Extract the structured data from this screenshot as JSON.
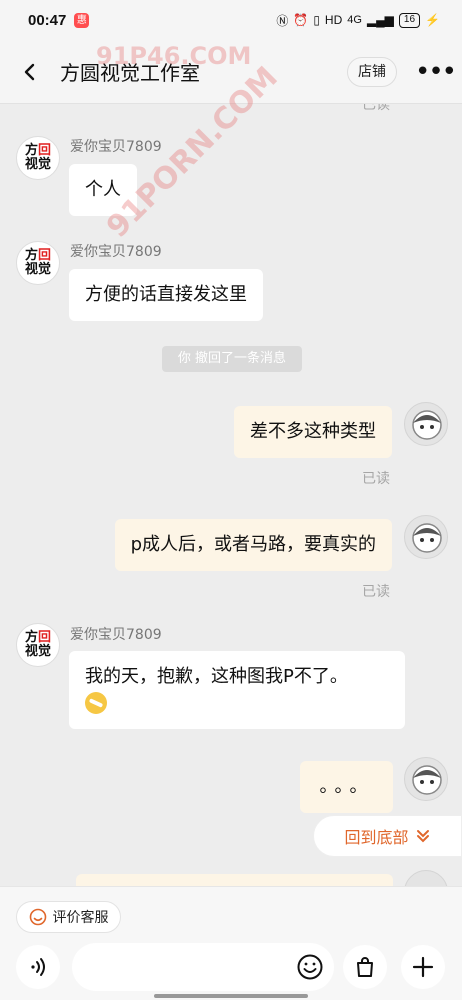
{
  "status_bar": {
    "time": "00:47",
    "app_icon": "惠",
    "network": "4G",
    "battery": "16",
    "icons": [
      "nfc-icon",
      "alarm-icon",
      "vibrate-icon",
      "hd-icon",
      "signal-icon",
      "charging-icon"
    ]
  },
  "header": {
    "title": "方圆视觉工作室",
    "shop_label": "店铺",
    "more_label": "•••"
  },
  "chat": {
    "top_read": "已读",
    "shop_avatar": {
      "line1": "方",
      "line1_red": "回",
      "line2": "视觉"
    },
    "messages": [
      {
        "sender": "爱你宝贝7809",
        "text": "个人"
      },
      {
        "sender": "爱你宝贝7809",
        "text": "方便的话直接发这里"
      },
      {
        "recall": "你 撤回了一条消息"
      },
      {
        "text": "差不多这种类型",
        "read": "已读"
      },
      {
        "text": "p成人后，或者马路，要真实的",
        "read": "已读"
      },
      {
        "sender": "爱你宝贝7809",
        "text": "我的天，抱歉，这种图我P不了。"
      },
      {
        "text": "。。。"
      }
    ]
  },
  "scroll_to_bottom": {
    "label": "回到底部"
  },
  "bottom": {
    "rate_label": "评价客服",
    "input_placeholder": ""
  },
  "watermarks": [
    "91P46.COM",
    "91PORN.COM",
    "91PORN.COM"
  ],
  "colors": {
    "accent": "#e0672c",
    "bubble_out": "#fdf5e6",
    "bubble_in": "#ffffff",
    "background": "#ededed"
  }
}
